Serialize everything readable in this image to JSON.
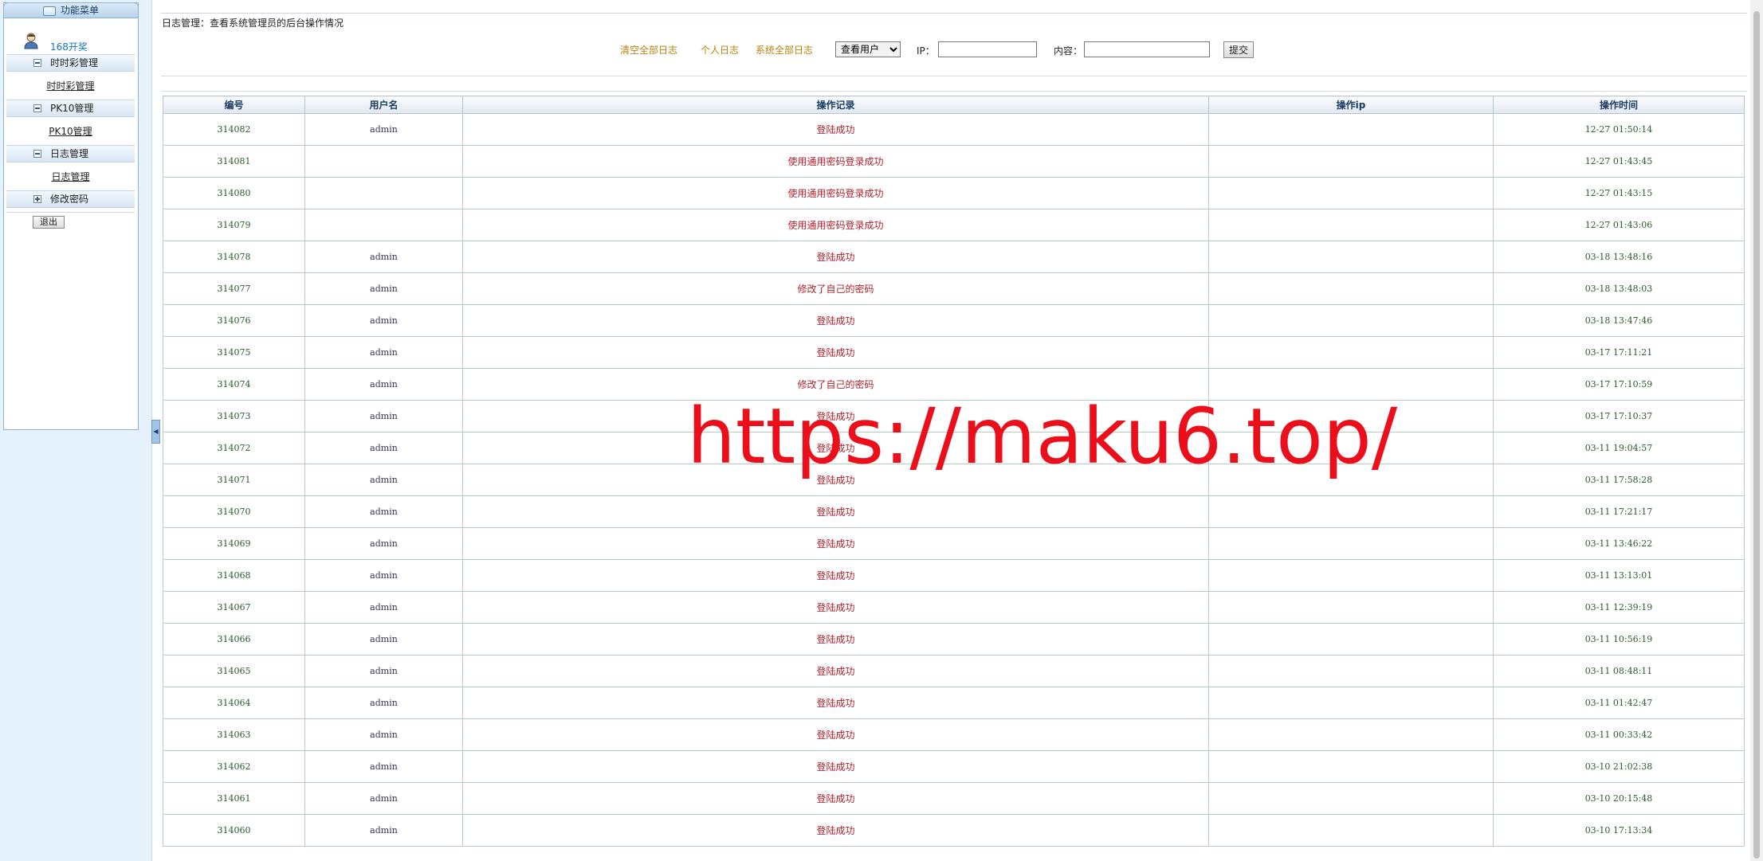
{
  "sidebar": {
    "header": "功能菜单",
    "brand": "168开奖",
    "sections": [
      {
        "label": "时时彩管理",
        "item": "时时彩管理",
        "state": "expanded"
      },
      {
        "label": "PK10管理",
        "item": "PK10管理",
        "state": "expanded"
      },
      {
        "label": "日志管理",
        "item": "日志管理",
        "state": "expanded"
      },
      {
        "label": "修改密码",
        "item": "",
        "state": "collapsed"
      }
    ],
    "logout": "退出"
  },
  "page": {
    "title": "日志管理：查看系统管理员的后台操作情况"
  },
  "toolbar": {
    "clear_all": "清空全部日志",
    "personal": "个人日志",
    "system_all": "系统全部日志",
    "user_select": "查看用户",
    "ip_label": "IP：",
    "ip_value": "",
    "content_label": "内容：",
    "content_value": "",
    "submit": "提交"
  },
  "table": {
    "headers": [
      "编号",
      "用户名",
      "操作记录",
      "操作ip",
      "操作时间"
    ],
    "rows": [
      {
        "id": "314082",
        "user": "admin",
        "action": "登陆成功",
        "ip": "",
        "time": "12-27 01:50:14"
      },
      {
        "id": "314081",
        "user": "",
        "action": "使用通用密码登录成功",
        "ip": "",
        "time": "12-27 01:43:45"
      },
      {
        "id": "314080",
        "user": "",
        "action": "使用通用密码登录成功",
        "ip": "",
        "time": "12-27 01:43:15"
      },
      {
        "id": "314079",
        "user": "",
        "action": "使用通用密码登录成功",
        "ip": "",
        "time": "12-27 01:43:06"
      },
      {
        "id": "314078",
        "user": "admin",
        "action": "登陆成功",
        "ip": "",
        "time": "03-18 13:48:16"
      },
      {
        "id": "314077",
        "user": "admin",
        "action": "修改了自己的密码",
        "ip": "",
        "time": "03-18 13:48:03"
      },
      {
        "id": "314076",
        "user": "admin",
        "action": "登陆成功",
        "ip": "",
        "time": "03-18 13:47:46"
      },
      {
        "id": "314075",
        "user": "admin",
        "action": "登陆成功",
        "ip": "",
        "time": "03-17 17:11:21"
      },
      {
        "id": "314074",
        "user": "admin",
        "action": "修改了自己的密码",
        "ip": "",
        "time": "03-17 17:10:59"
      },
      {
        "id": "314073",
        "user": "admin",
        "action": "登陆成功",
        "ip": "",
        "time": "03-17 17:10:37"
      },
      {
        "id": "314072",
        "user": "admin",
        "action": "登陆成功",
        "ip": "",
        "time": "03-11 19:04:57"
      },
      {
        "id": "314071",
        "user": "admin",
        "action": "登陆成功",
        "ip": "",
        "time": "03-11 17:58:28"
      },
      {
        "id": "314070",
        "user": "admin",
        "action": "登陆成功",
        "ip": "",
        "time": "03-11 17:21:17"
      },
      {
        "id": "314069",
        "user": "admin",
        "action": "登陆成功",
        "ip": "",
        "time": "03-11 13:46:22"
      },
      {
        "id": "314068",
        "user": "admin",
        "action": "登陆成功",
        "ip": "",
        "time": "03-11 13:13:01"
      },
      {
        "id": "314067",
        "user": "admin",
        "action": "登陆成功",
        "ip": "",
        "time": "03-11 12:39:19"
      },
      {
        "id": "314066",
        "user": "admin",
        "action": "登陆成功",
        "ip": "",
        "time": "03-11 10:56:19"
      },
      {
        "id": "314065",
        "user": "admin",
        "action": "登陆成功",
        "ip": "",
        "time": "03-11 08:48:11"
      },
      {
        "id": "314064",
        "user": "admin",
        "action": "登陆成功",
        "ip": "",
        "time": "03-11 01:42:47"
      },
      {
        "id": "314063",
        "user": "admin",
        "action": "登陆成功",
        "ip": "",
        "time": "03-11 00:33:42"
      },
      {
        "id": "314062",
        "user": "admin",
        "action": "登陆成功",
        "ip": "",
        "time": "03-10 21:02:38"
      },
      {
        "id": "314061",
        "user": "admin",
        "action": "登陆成功",
        "ip": "",
        "time": "03-10 20:15:48"
      },
      {
        "id": "314060",
        "user": "admin",
        "action": "登陆成功",
        "ip": "",
        "time": "03-10 17:13:34"
      }
    ]
  },
  "watermark": "https://maku6.top/",
  "colors": {
    "toolbar_link": "#b9830f",
    "action_text": "#b3202a",
    "header_text": "#1a3e66",
    "sidebar_bg": "#e5f1fb",
    "watermark": "#ea0f1a"
  },
  "icons": {
    "menu_header": "menu-icon",
    "brand": "user-avatar-icon",
    "section_expanded": "minus-box-icon",
    "section_collapsed": "plus-box-icon",
    "collapse_tab": "chevron-left-icon"
  }
}
